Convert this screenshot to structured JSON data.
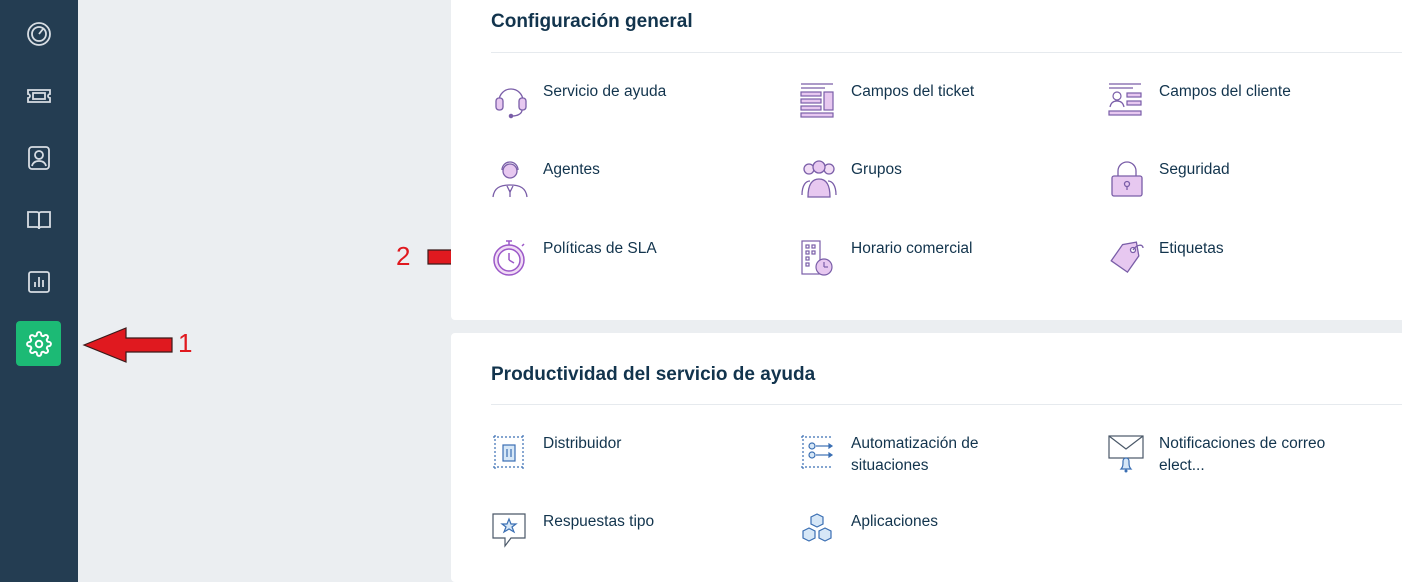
{
  "sidebar": {
    "items": [
      {
        "name": "dashboard",
        "icon": "dashboard-icon"
      },
      {
        "name": "tickets",
        "icon": "ticket-icon"
      },
      {
        "name": "contacts",
        "icon": "contact-icon"
      },
      {
        "name": "knowledge-base",
        "icon": "book-icon"
      },
      {
        "name": "reports",
        "icon": "reports-icon"
      },
      {
        "name": "admin",
        "icon": "gear-icon",
        "active": true
      }
    ],
    "accent": "#1cba75",
    "background": "#243d52"
  },
  "general": {
    "title": "Configuración general",
    "items": [
      {
        "label": "Servicio de ayuda",
        "icon": "headset-icon"
      },
      {
        "label": "Campos del ticket",
        "icon": "ticket-fields-icon"
      },
      {
        "label": "Campos del cliente",
        "icon": "customer-fields-icon"
      },
      {
        "label": "Agentes",
        "icon": "agent-icon"
      },
      {
        "label": "Grupos",
        "icon": "groups-icon"
      },
      {
        "label": "Seguridad",
        "icon": "lock-icon"
      },
      {
        "label": "Políticas de SLA",
        "icon": "stopwatch-icon"
      },
      {
        "label": "Horario comercial",
        "icon": "business-hours-icon"
      },
      {
        "label": "Etiquetas",
        "icon": "tag-icon"
      }
    ]
  },
  "productivity": {
    "title": "Productividad del servicio de ayuda",
    "items": [
      {
        "label": "Distribuidor",
        "icon": "dispatcher-icon"
      },
      {
        "label": "Automatización de situaciones",
        "icon": "automation-icon"
      },
      {
        "label": "Notificaciones de correo elect...",
        "icon": "email-notification-icon"
      },
      {
        "label": "Respuestas tipo",
        "icon": "canned-response-icon"
      },
      {
        "label": "Aplicaciones",
        "icon": "apps-icon"
      }
    ]
  },
  "annotations": {
    "one": "1",
    "two": "2",
    "color": "#e0191f"
  }
}
